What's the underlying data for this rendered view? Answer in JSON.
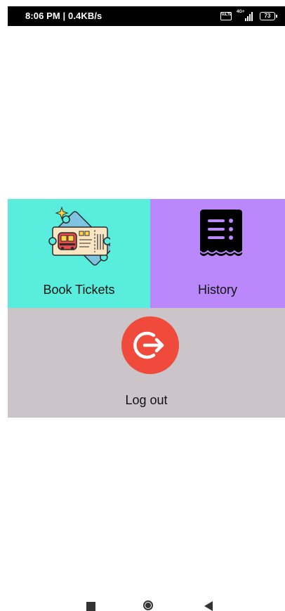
{
  "status_bar": {
    "time_speed": "8:06 PM | 0.4KB/s",
    "volte": "VoLTE",
    "network": "4G+",
    "battery_level": "73"
  },
  "menu": {
    "book_tickets_label": "Book Tickets",
    "history_label": "History",
    "logout_label": "Log out"
  },
  "colors": {
    "book_tile": "#58eddc",
    "history_tile": "#bb88fb",
    "logout_tile": "#cbc5ca",
    "logout_circle": "#f04a3c"
  },
  "icons": {
    "book": "train-ticket-icon",
    "history": "receipt-icon",
    "logout": "logout-arrow-icon",
    "nav_recents": "square-icon",
    "nav_home": "circle-icon",
    "nav_back": "back-triangle-icon"
  }
}
